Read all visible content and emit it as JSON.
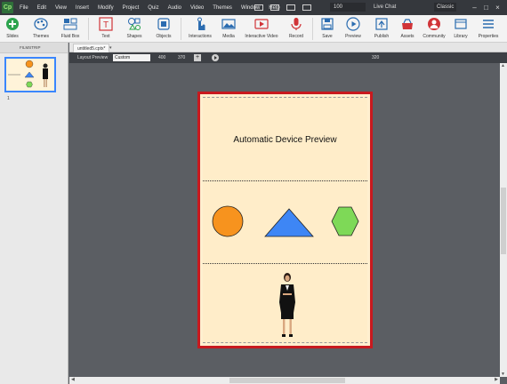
{
  "app": {
    "logo": "Cp"
  },
  "menubar": {
    "items": [
      "File",
      "Edit",
      "View",
      "Insert",
      "Modify",
      "Project",
      "Quiz",
      "Audio",
      "Video",
      "Themes",
      "Window",
      "Help"
    ],
    "zoom_value": "100",
    "live_chat": "Live Chat",
    "user": "Classic"
  },
  "ribbon": {
    "buttons": [
      {
        "label": "Slides",
        "icon": "add-slide-icon"
      },
      {
        "label": "Themes",
        "icon": "palette-icon"
      },
      {
        "label": "Fluid Box",
        "icon": "fluid-box-icon"
      },
      {
        "label": "Text",
        "icon": "text-icon"
      },
      {
        "label": "Shapes",
        "icon": "shapes-icon"
      },
      {
        "label": "Objects",
        "icon": "objects-icon"
      },
      {
        "label": "Interactions",
        "icon": "interactions-icon"
      },
      {
        "label": "Media",
        "icon": "media-icon"
      },
      {
        "label": "Interactive Video",
        "icon": "interactive-video-icon"
      },
      {
        "label": "Record",
        "icon": "microphone-icon"
      },
      {
        "label": "Save",
        "icon": "save-icon"
      },
      {
        "label": "Preview",
        "icon": "preview-play-icon"
      },
      {
        "label": "Publish",
        "icon": "publish-icon"
      },
      {
        "label": "Assets",
        "icon": "assets-icon"
      },
      {
        "label": "Community",
        "icon": "community-icon"
      },
      {
        "label": "Library",
        "icon": "library-icon"
      },
      {
        "label": "Properties",
        "icon": "properties-icon"
      }
    ]
  },
  "filmstrip": {
    "header": "FILMSTRIP",
    "slide_number": "1"
  },
  "document": {
    "tab_name": "untitled5.cptx*"
  },
  "preview_bar": {
    "label": "Layout Preview",
    "device_select": "Custom",
    "width_value": "400",
    "height_value": "370",
    "right_value": "320"
  },
  "slide": {
    "title": "Automatic Device Preview"
  },
  "colors": {
    "slide_bg": "#ffedc9",
    "frame_border": "#c8191e",
    "circle": "#f7931e",
    "triangle": "#3e86f5",
    "hexagon": "#7ed957",
    "accent": "#3a86ff"
  }
}
